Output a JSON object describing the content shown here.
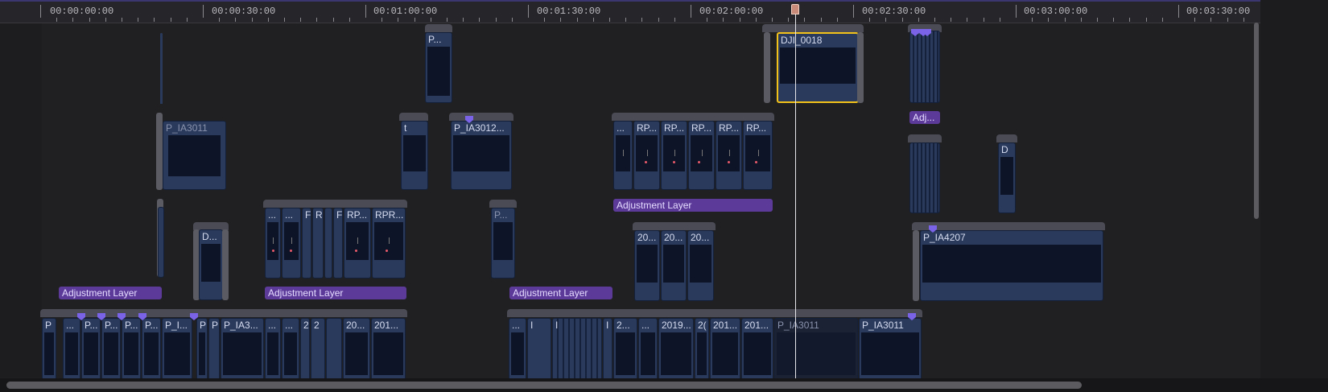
{
  "ruler": {
    "timecodes": [
      "00:00:00:00",
      "00:00:30:00",
      "00:01:00:00",
      "00:01:30:00",
      "00:02:00:00",
      "00:02:30:00",
      "00:03:00:00",
      "00:03:30:00"
    ]
  },
  "playhead": {
    "time_label": ""
  },
  "clips": {
    "c1": "P...",
    "c2": "DJI_0018",
    "c3": "P_IA3011",
    "c4": "t",
    "c5": "P_IA3012...",
    "c6a": "...",
    "c6b": "RP...",
    "c6c": "RP...",
    "c6d": "RP...",
    "c6e": "RP...",
    "c6f": "RP...",
    "c7": "Adj...",
    "c8": "D",
    "c9": "D...",
    "c10a": "...",
    "c10b": "...",
    "c10c": "F",
    "c10d": "R",
    "c10e": "F",
    "c10f": "RP...",
    "c10g": "RPR...",
    "c11": "P...",
    "c12a": "20...",
    "c12b": "20...",
    "c12c": "20...",
    "c13": "P_IA4207",
    "s1": "P",
    "s2": "...",
    "s3": "P...",
    "s4": "P...",
    "s5": "P...",
    "s6": "P...",
    "s7": "P_I...",
    "s8": "P",
    "s9": "P",
    "s10": "P_IA3...",
    "s11": "...",
    "s12": "...",
    "s13": "2",
    "s14": "2",
    "s15": "20...",
    "s16": "201...",
    "s17": "...",
    "s18": "I",
    "s19": "I",
    "s20": "I",
    "s21": "2...",
    "s22": "...",
    "s23": "2019...",
    "s24": "2(",
    "s25": "201...",
    "s26": "201...",
    "s27": "P_IA3011",
    "s28": "P_IA3011"
  },
  "adjustment_layers": {
    "a1": "Adjustment Layer",
    "a2": "Adjustment Layer",
    "a3": "Adjustment Layer",
    "a4": "Adjustment Layer"
  },
  "colors": {
    "clip_blue": "#2a3a5c",
    "adjustment_purple": "#5b3a9a",
    "marker": "#7a63e6",
    "selection_yellow": "#f2c21a",
    "playhead": "#e6e6ea"
  }
}
